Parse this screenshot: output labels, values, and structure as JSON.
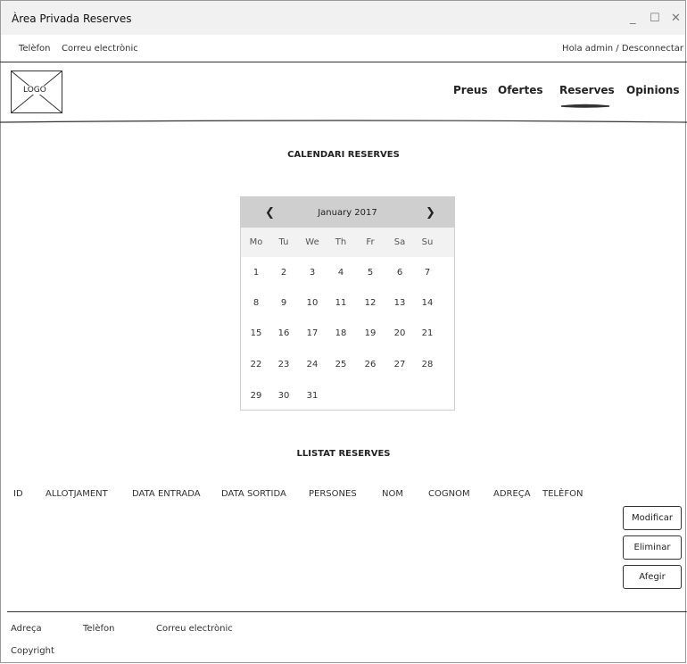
{
  "window": {
    "title": "Àrea Privada Reserves",
    "controls": [
      "_",
      "☐",
      "✕"
    ]
  },
  "topbar": {
    "phone": "Telèfon",
    "email": "Correu electrònic",
    "user": "Hola admin / Desconnectar"
  },
  "logo": {
    "label": "LOGO"
  },
  "nav": {
    "items": [
      "Preus",
      "Ofertes",
      "Reserves",
      "Opinions"
    ],
    "active": "Reserves"
  },
  "calendar": {
    "title": "CALENDARI RESERVES",
    "prev": "❮",
    "next": "❯",
    "month": "January 2017",
    "days_of_week": [
      "Mo",
      "Tu",
      "We",
      "Th",
      "Fr",
      "Sa",
      "Su"
    ],
    "weeks": [
      [
        "1",
        "2",
        "3",
        "4",
        "5",
        "6",
        "7"
      ],
      [
        "8",
        "9",
        "10",
        "11",
        "12",
        "13",
        "14"
      ],
      [
        "15",
        "16",
        "17",
        "18",
        "19",
        "20",
        "21"
      ],
      [
        "22",
        "23",
        "24",
        "25",
        "26",
        "27",
        "28"
      ],
      [
        "29",
        "30",
        "31",
        "",
        "",
        "",
        ""
      ]
    ]
  },
  "list": {
    "title": "LLISTAT RESERVES",
    "columns": [
      "ID",
      "ALLOTJAMENT",
      "DATA ENTRADA",
      "DATA SORTIDA",
      "PERSONES",
      "NOM",
      "COGNOM",
      "ADREÇA",
      "TELÈFON"
    ],
    "actions": {
      "modify": "Modificar",
      "delete": "Eliminar",
      "add": "Afegir"
    }
  },
  "footer": {
    "address": "Adreça",
    "phone": "Telèfon",
    "email": "Correu electrònic",
    "copyright": "Copyright"
  }
}
